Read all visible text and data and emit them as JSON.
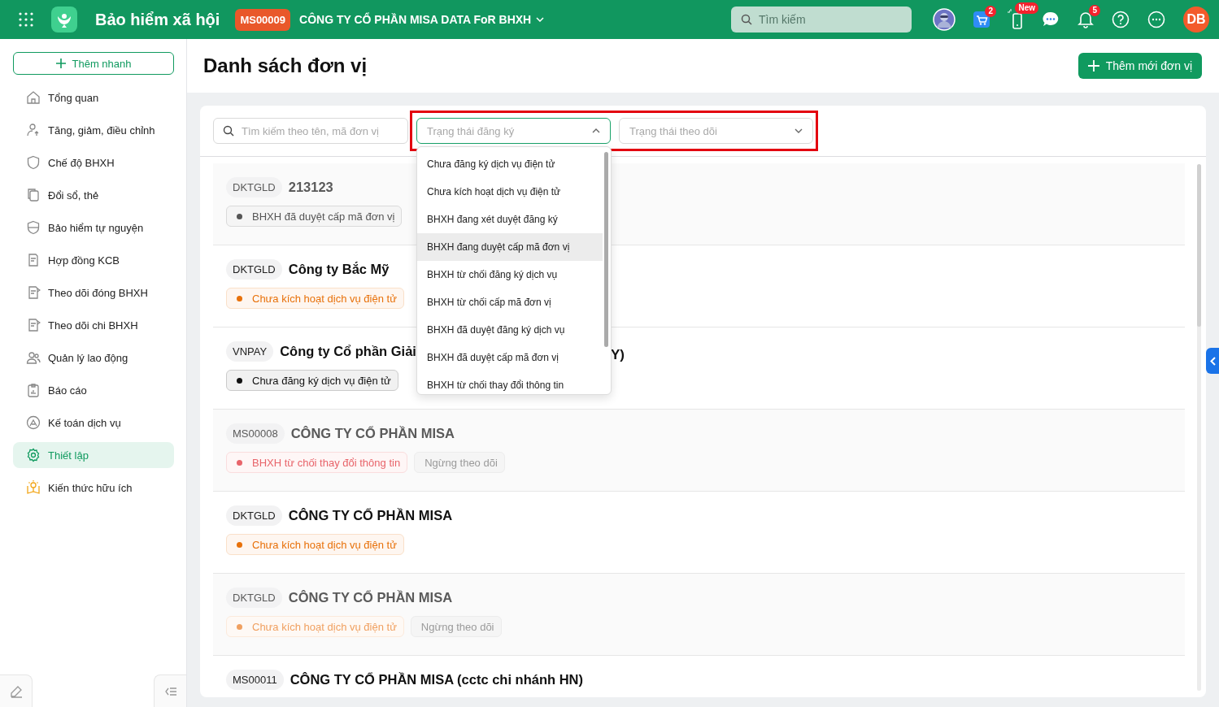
{
  "topbar": {
    "app_title": "Bảo hiểm xã hội",
    "unit_code": "MS00009",
    "company": "CÔNG TY CỔ PHẦN MISA DATA FoR BHXH",
    "search": {
      "placeholder": "Tìm kiếm"
    },
    "cart_badge": "2",
    "phone_badge": "New",
    "bell_badge": "5",
    "user_initials": "DB"
  },
  "sidebar": {
    "quick_add": "Thêm nhanh",
    "items": [
      {
        "label": "Tổng quan",
        "selected": false
      },
      {
        "label": "Tăng, giảm, điều chỉnh",
        "selected": false
      },
      {
        "label": "Chế độ BHXH",
        "selected": false
      },
      {
        "label": "Đổi sổ, thẻ",
        "selected": false
      },
      {
        "label": "Bảo hiểm tự nguyện",
        "selected": false
      },
      {
        "label": "Hợp đồng KCB",
        "selected": false
      },
      {
        "label": "Theo dõi đóng BHXH",
        "selected": false
      },
      {
        "label": "Theo dõi chi BHXH",
        "selected": false
      },
      {
        "label": "Quản lý lao động",
        "selected": false
      },
      {
        "label": "Báo cáo",
        "selected": false
      },
      {
        "label": "Kế toán dịch vụ",
        "selected": false
      },
      {
        "label": "Thiết lập",
        "selected": true
      },
      {
        "label": "Kiến thức hữu ích",
        "selected": false
      }
    ]
  },
  "page": {
    "title": "Danh sách đơn vị",
    "add_button": "Thêm mới đơn vị"
  },
  "filters": {
    "search": {
      "placeholder": "Tìm kiếm theo tên, mã đơn vị"
    },
    "registration_status": {
      "placeholder": "Trạng thái đăng ký",
      "expanded": true
    },
    "tracking_status": {
      "placeholder": "Trạng thái theo dõi",
      "expanded": false
    }
  },
  "dropdown_options": [
    {
      "label": "Chưa đăng ký dịch vụ điện tử",
      "highlighted": false
    },
    {
      "label": "Chưa kích hoạt dịch vụ điện tử",
      "highlighted": false
    },
    {
      "label": "BHXH đang xét duyệt đăng ký",
      "highlighted": false
    },
    {
      "label": "BHXH đang duyệt cấp mã đơn vị",
      "highlighted": true
    },
    {
      "label": "BHXH từ chối đăng ký dịch vụ",
      "highlighted": false
    },
    {
      "label": "BHXH từ chối cấp mã đơn vị",
      "highlighted": false
    },
    {
      "label": "BHXH đã duyệt đăng ký dịch vụ",
      "highlighted": false
    },
    {
      "label": "BHXH đã duyệt cấp mã đơn vị",
      "highlighted": false
    },
    {
      "label": "BHXH từ chối thay đổi thông tin",
      "highlighted": false
    }
  ],
  "units": [
    {
      "code": "DKTGLD",
      "name": "213123",
      "stopped": true,
      "tags": [
        {
          "kind": "status",
          "label": "BHXH đã duyệt cấp mã đơn vị",
          "color": "#555555"
        }
      ]
    },
    {
      "code": "DKTGLD",
      "name": "Công ty Bắc Mỹ",
      "stopped": false,
      "tags": [
        {
          "kind": "status",
          "label": "Chưa kích hoạt dịch vụ điện tử",
          "color": "#e8710a"
        }
      ]
    },
    {
      "code": "VNPAY",
      "name": "Công ty Cổ phần Giải",
      "name_tail": "Y)",
      "stopped": false,
      "tags": [
        {
          "kind": "status",
          "label": "Chưa đăng ký dịch vụ điện tử",
          "color": "#111111"
        }
      ]
    },
    {
      "code": "MS00008",
      "name": "CÔNG TY CỔ PHẦN MISA",
      "stopped": true,
      "tags": [
        {
          "kind": "status",
          "label": "BHXH từ chối thay đổi thông tin",
          "color": "#e8646a"
        },
        {
          "kind": "tracking",
          "label": "Ngừng theo dõi"
        }
      ]
    },
    {
      "code": "DKTGLD",
      "name": "CÔNG TY CỔ PHẦN MISA",
      "stopped": false,
      "tags": [
        {
          "kind": "status",
          "label": "Chưa kích hoạt dịch vụ điện tử",
          "color": "#e8710a"
        }
      ]
    },
    {
      "code": "DKTGLD",
      "name": "CÔNG TY CỔ PHẦN MISA",
      "stopped": true,
      "tags": [
        {
          "kind": "status",
          "label": "Chưa kích hoạt dịch vụ điện tử",
          "color": "#f0a060"
        },
        {
          "kind": "tracking",
          "label": "Ngừng theo dõi"
        }
      ]
    },
    {
      "code": "MS00011",
      "name": "CÔNG TY CỔ PHẦN MISA (cctc chi nhánh HN)",
      "stopped": false
    }
  ]
}
